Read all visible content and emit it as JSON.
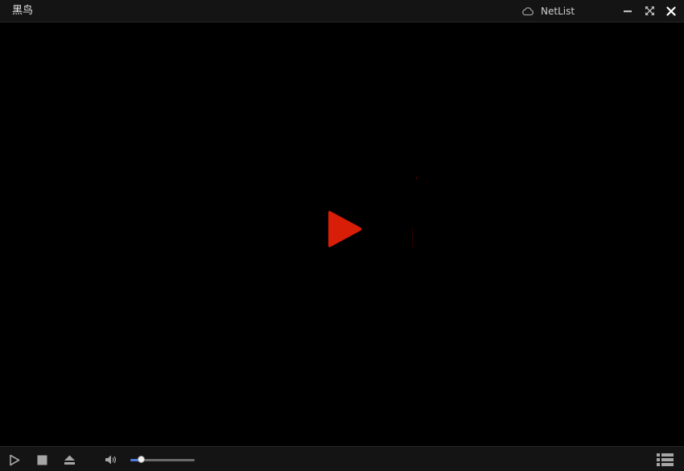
{
  "window": {
    "title": "黑鸟",
    "netlist_label": "NetList",
    "controls": [
      "minimize-icon",
      "maximize-icon",
      "close-icon"
    ]
  },
  "video": {
    "state": "stopped",
    "center_icon": "play-icon",
    "accent_color": "#d81e06"
  },
  "controlbar": {
    "buttons": [
      "play-icon",
      "stop-icon",
      "eject-icon",
      "volume-icon",
      "playlist-icon"
    ],
    "volume_level": 0.18,
    "volume_color": "#4f7be0"
  }
}
